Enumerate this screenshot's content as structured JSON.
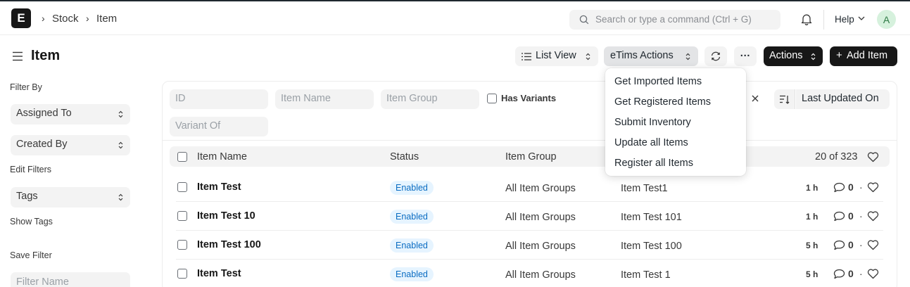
{
  "navbar": {
    "logo_letter": "E",
    "breadcrumbs": [
      "Stock",
      "Item"
    ],
    "search_placeholder": "Search or type a command (Ctrl + G)",
    "help_label": "Help",
    "avatar_letter": "A"
  },
  "page": {
    "title": "Item",
    "list_view_label": "List View",
    "etims_label": "eTims Actions",
    "actions_label": "Actions",
    "add_label": "Add Item",
    "more_label": "···"
  },
  "sidebar": {
    "filter_by": "Filter By",
    "assigned_to": "Assigned To",
    "created_by": "Created By",
    "edit_filters": "Edit Filters",
    "tags": "Tags",
    "show_tags": "Show Tags",
    "save_filter": "Save Filter",
    "filter_name_placeholder": "Filter Name"
  },
  "filters": {
    "id_placeholder": "ID",
    "item_name_placeholder": "Item Name",
    "item_group_placeholder": "Item Group",
    "has_variants_label": "Has Variants",
    "variant_of_placeholder": "Variant Of",
    "sort_label": "Last Updated On"
  },
  "table": {
    "columns": [
      "Item Name",
      "Status",
      "Item Group"
    ],
    "count": "20 of 323",
    "rows": [
      {
        "name": "Item Test",
        "status": "Enabled",
        "group": "All Item Groups",
        "code": "Item Test1",
        "time": "1 h",
        "comments": "0"
      },
      {
        "name": "Item Test 10",
        "status": "Enabled",
        "group": "All Item Groups",
        "code": "Item Test 101",
        "time": "1 h",
        "comments": "0"
      },
      {
        "name": "Item Test 100",
        "status": "Enabled",
        "group": "All Item Groups",
        "code": "Item Test 100",
        "time": "5 h",
        "comments": "0"
      },
      {
        "name": "Item Test",
        "status": "Enabled",
        "group": "All Item Groups",
        "code": "Item Test 1",
        "time": "5 h",
        "comments": "0"
      }
    ]
  },
  "dropdown": {
    "items": [
      "Get Imported Items",
      "Get Registered Items",
      "Submit Inventory",
      "Update all Items",
      "Register all Items"
    ]
  },
  "colors": {
    "dark": "#171717",
    "badge_bg": "#e6f4ff",
    "badge_text": "#0a6cc2",
    "avatar_bg": "#d6f1dd"
  }
}
